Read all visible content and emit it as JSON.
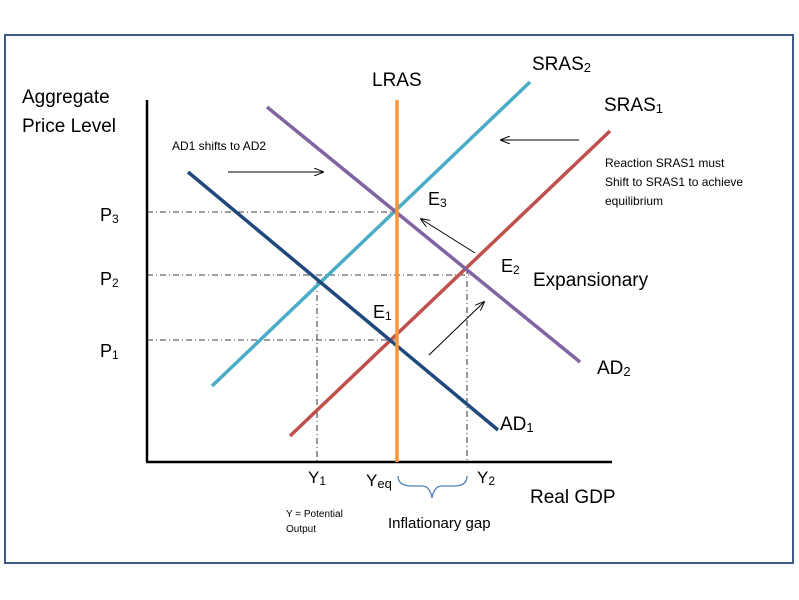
{
  "labels": {
    "y_axis_line1": "Aggregate",
    "y_axis_line2": "Price Level",
    "x_axis": "Real GDP",
    "lras": "LRAS",
    "sras2": "SRAS",
    "sras2_sub": "2",
    "sras1": "SRAS",
    "sras1_sub": "1",
    "ad1": "AD",
    "ad1_sub": "1",
    "ad2": "AD",
    "ad2_sub": "2",
    "e1": "E",
    "e1_sub": "1",
    "e2": "E",
    "e2_sub": "2",
    "e3": "E",
    "e3_sub": "3",
    "p3": "P",
    "p3_sub": "3",
    "p2": "P",
    "p2_sub": "2",
    "p1": "P",
    "p1_sub": "1",
    "y1": "Y",
    "y1_sub": "1",
    "yeq": "Y",
    "yeq_sub": "eq",
    "y2": "Y",
    "y2_sub": "2",
    "ad_shift_note": "AD1 shifts to AD2",
    "reaction_line1": "Reaction SRAS1 must",
    "reaction_line2": "Shift to SRAS1 to achieve",
    "reaction_line3": "equilibrium",
    "expansionary": "Expansionary",
    "potential_line1": "Y = Potential",
    "potential_line2": "Output",
    "gap": "Inflationary gap"
  },
  "colors": {
    "frame": "#3b5b86",
    "lras": "#f7963c",
    "sras2": "#4bacc6",
    "sras1": "#c0504d",
    "ad1": "#1f497d",
    "ad2": "#8064a2",
    "gap_brace": "#4f81bd",
    "axis": "#000000"
  }
}
